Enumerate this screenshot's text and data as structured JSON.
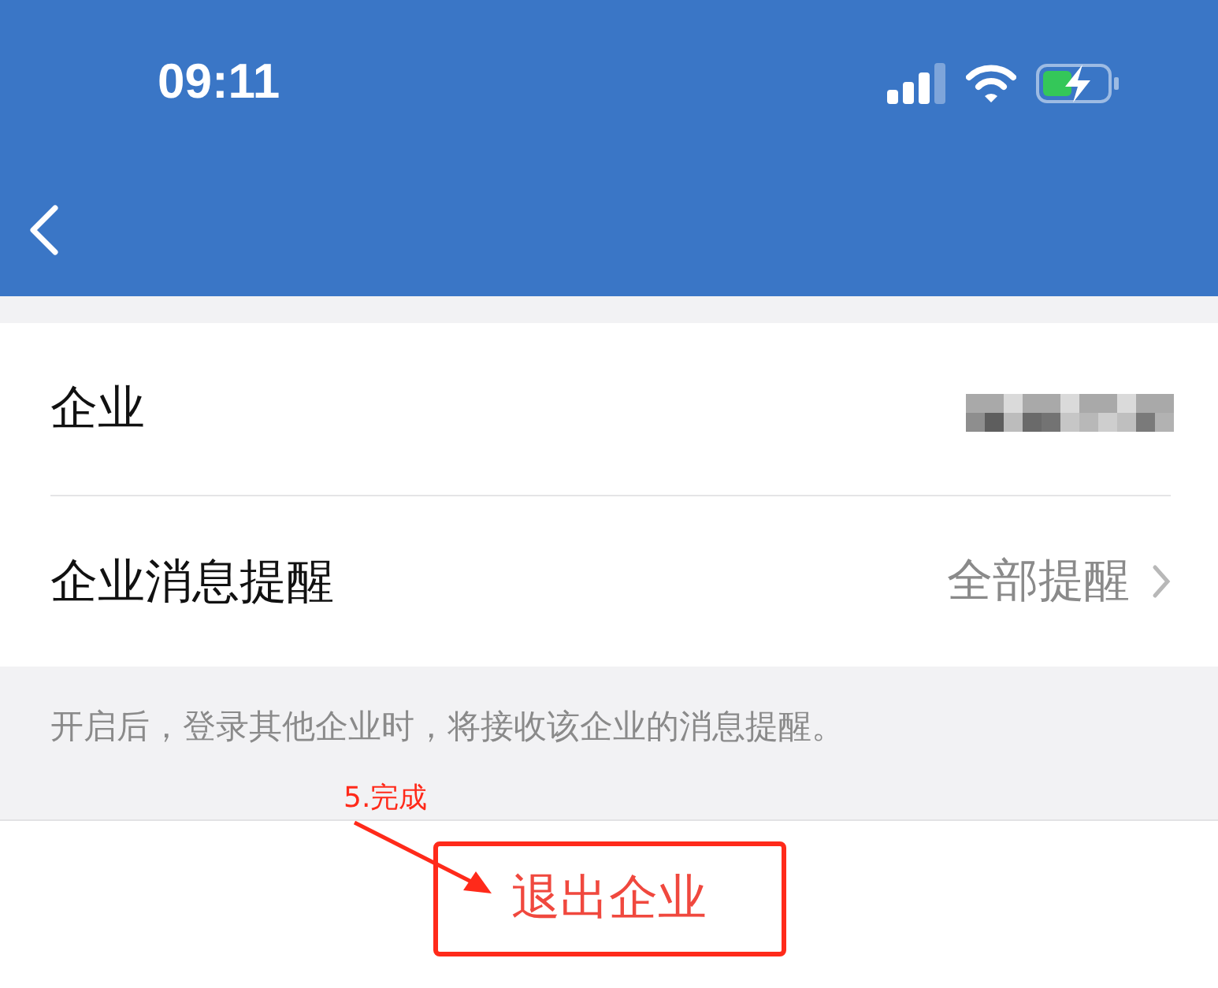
{
  "status_bar": {
    "time": "09:11"
  },
  "rows": [
    {
      "kind": "redacted",
      "label": "企业"
    },
    {
      "kind": "link",
      "label": "企业消息提醒",
      "value": "全部提醒"
    }
  ],
  "hint": "开启后，登录其他企业时，将接收该企业的消息提醒。",
  "button": {
    "label": "退出企业"
  },
  "annotation": {
    "label": "5.完成"
  }
}
